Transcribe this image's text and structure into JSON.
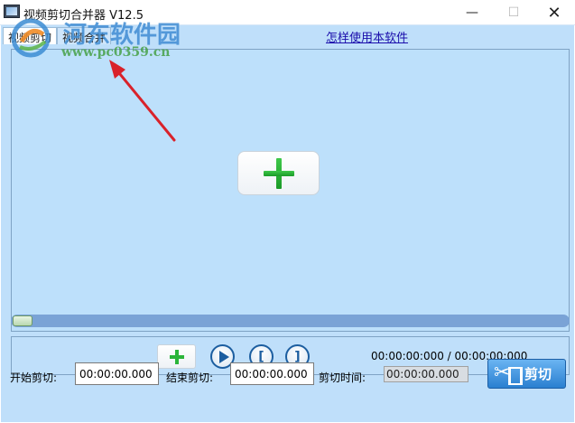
{
  "window": {
    "title": "视频剪切合并器 V12.5",
    "minimize_glyph": "—",
    "maximize_glyph": "☐",
    "close_glyph": "✕"
  },
  "tabs": [
    {
      "label": "视频剪切",
      "active": true
    },
    {
      "label": "视频合并",
      "active": false
    }
  ],
  "help_link": "怎样使用本软件",
  "player": {
    "progress": 0.0,
    "time_readout": "00:00:00:000 / 00:00:00:000"
  },
  "bottom": {
    "start_label": "开始剪切:",
    "start_value": "00:00:00.000",
    "end_label": "结束剪切:",
    "end_value": "00:00:00.000",
    "duration_label": "剪切时间:",
    "duration_value": "00:00:00.000",
    "cut_button": "剪切"
  },
  "watermark": {
    "brand": "河东软件园",
    "url": "www.pc0359.cn"
  },
  "icons": [
    "app-icon",
    "plus-icon",
    "play-icon",
    "set-start-icon",
    "set-end-icon",
    "scissors-icon"
  ],
  "colors": {
    "client_bg": "#bfdffa",
    "progress_track": "#7aa3d6",
    "accent_green": "#2bb53a",
    "button_blue": "#2a7fd0",
    "annotation_red": "#d9222a"
  }
}
